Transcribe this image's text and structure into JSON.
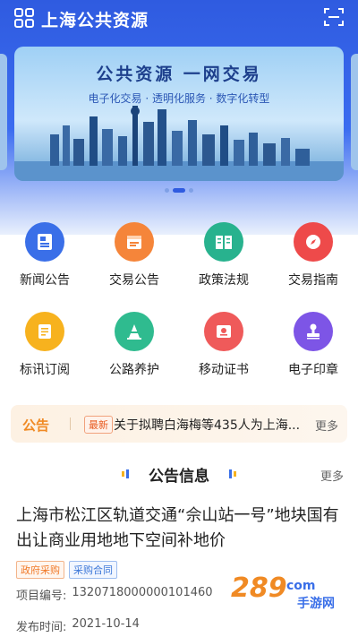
{
  "header": {
    "app_title": "上海公共资源",
    "logo_icon": "grid-logo-icon",
    "scan_icon": "scan-icon"
  },
  "banner": {
    "title": "公共资源  一网交易",
    "subtitle": "电子化交易 · 透明化服务 · 数字化转型",
    "carousel": {
      "count": 3,
      "active_index": 1
    }
  },
  "grid_items": [
    {
      "label": "新闻公告",
      "icon": "news-icon",
      "color": "#3a6fe8"
    },
    {
      "label": "交易公告",
      "icon": "calendar-icon",
      "color": "#f5853a"
    },
    {
      "label": "政策法规",
      "icon": "book-icon",
      "color": "#28b28e"
    },
    {
      "label": "交易指南",
      "icon": "compass-icon",
      "color": "#ee4a4a"
    },
    {
      "label": "标讯订阅",
      "icon": "subscribe-icon",
      "color": "#f7b21e"
    },
    {
      "label": "公路养护",
      "icon": "cone-icon",
      "color": "#2fbb8f"
    },
    {
      "label": "移动证书",
      "icon": "certificate-icon",
      "color": "#ef5a5a"
    },
    {
      "label": "电子印章",
      "icon": "stamp-icon",
      "color": "#7d55e6"
    }
  ],
  "notice": {
    "logo_text": "公告",
    "badge": "最新",
    "text": "关于拟聘白海梅等435人为上海...",
    "more": "更多"
  },
  "section": {
    "title": "公告信息",
    "more": "更多"
  },
  "article": {
    "title": "上海市松江区轨道交通“佘山站一号”地块国有出让商业用地地下空间补地价",
    "tags": [
      "政府采购",
      "采购合同"
    ],
    "project_no_label": "项目编号:",
    "project_no": "1320718000000101460",
    "publish_label": "发布时间:",
    "publish_date": "2021-10-14"
  },
  "watermark": {
    "number": "289",
    "suffix": "com",
    "text": "手游网"
  }
}
